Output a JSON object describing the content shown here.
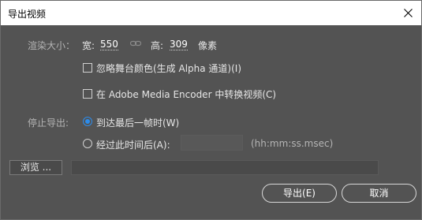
{
  "dialog": {
    "title": "导出视频"
  },
  "render_size": {
    "label": "渲染大小：",
    "width_label": "宽:",
    "width_value": "550",
    "height_label": "高:",
    "height_value": "309",
    "unit": "像素"
  },
  "options": {
    "ignore_stage_color": {
      "label": "忽略舞台颜色(生成 Alpha 通道)(I)",
      "checked": false
    },
    "convert_in_encoder": {
      "label": "在 Adobe Media Encoder 中转换视频(C)",
      "checked": false
    }
  },
  "stop_export": {
    "label": "停止导出:",
    "option_last_frame": "到达最后一帧时(W)",
    "option_time_elapsed": "经过此时间后(A):",
    "selected": "option_last_frame",
    "time_value": "",
    "time_format": "(hh:mm:ss.msec)"
  },
  "browse": {
    "button_label": "浏览 ...",
    "path": ""
  },
  "buttons": {
    "export": "导出(E)",
    "cancel": "取消"
  }
}
